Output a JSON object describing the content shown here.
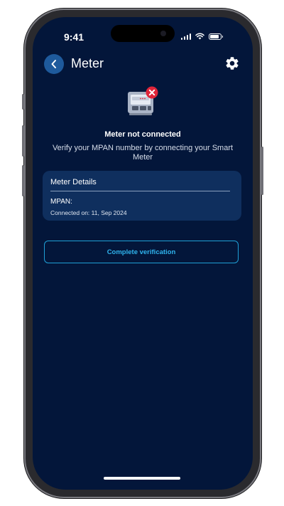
{
  "status_bar": {
    "time": "9:41",
    "battery_level": 0.85
  },
  "header": {
    "title": "Meter"
  },
  "status": {
    "title": "Meter not connected",
    "description": "Verify your MPAN number by connecting your Smart Meter"
  },
  "meter_details": {
    "title": "Meter Details",
    "mpan_label": "MPAN:",
    "connected_on": "Connected on: 11, Sep 2024"
  },
  "actions": {
    "verify_label": "Complete verification"
  },
  "colors": {
    "background": "#03163a",
    "card": "#0f2f5e",
    "accent": "#2fb4ee",
    "back_button": "#1e5a9c",
    "error_badge": "#e0253a"
  },
  "icons": {
    "back": "chevron-left-icon",
    "settings": "gear-icon",
    "meter": "smart-meter-icon",
    "error": "close-icon"
  }
}
